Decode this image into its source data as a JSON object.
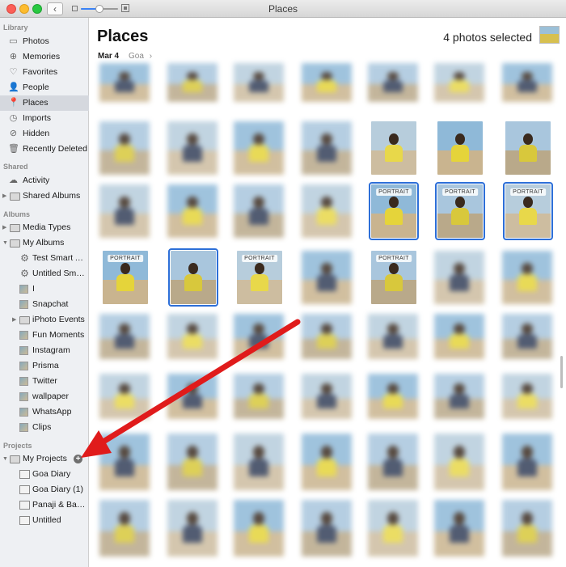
{
  "window": {
    "title": "Places"
  },
  "toolbar": {
    "back_glyph": "‹",
    "zoom_level": 0.5
  },
  "sidebar": {
    "sections": [
      {
        "key": "library",
        "label": "Library"
      },
      {
        "key": "shared",
        "label": "Shared"
      },
      {
        "key": "albums",
        "label": "Albums"
      },
      {
        "key": "projects",
        "label": "Projects"
      }
    ],
    "items": [
      {
        "label": "Photos",
        "icon": "photos-icon",
        "glyph": "▭"
      },
      {
        "label": "Memories",
        "icon": "memories-icon",
        "glyph": "⊕"
      },
      {
        "label": "Favorites",
        "icon": "heart-icon",
        "glyph": "♡"
      },
      {
        "label": "People",
        "icon": "person-icon",
        "glyph": "👤"
      },
      {
        "label": "Places",
        "icon": "pin-icon",
        "glyph": "📍",
        "selected": true
      },
      {
        "label": "Imports",
        "icon": "clock-icon",
        "glyph": "◷"
      },
      {
        "label": "Hidden",
        "icon": "eye-slash-icon",
        "glyph": "⊘"
      },
      {
        "label": "Recently Deleted",
        "icon": "trash-icon",
        "glyph": "🗑"
      },
      {
        "label": "Activity",
        "icon": "cloud-icon",
        "glyph": "☁"
      },
      {
        "label": "Shared Albums",
        "icon": "folder-icon",
        "glyph": ""
      },
      {
        "label": "Media Types",
        "icon": "folder-icon",
        "glyph": ""
      },
      {
        "label": "My Albums",
        "icon": "folder-icon",
        "glyph": ""
      },
      {
        "label": "Test Smart Album",
        "icon": "gear-icon",
        "glyph": "⚙"
      },
      {
        "label": "Untitled Smart Album",
        "icon": "gear-icon",
        "glyph": "⚙"
      },
      {
        "label": "I",
        "icon": "album-thumb-icon",
        "glyph": ""
      },
      {
        "label": "Snapchat",
        "icon": "album-thumb-icon",
        "glyph": ""
      },
      {
        "label": "iPhoto Events",
        "icon": "folder-icon",
        "glyph": ""
      },
      {
        "label": "Fun Moments",
        "icon": "album-thumb-icon",
        "glyph": ""
      },
      {
        "label": "Instagram",
        "icon": "album-thumb-icon",
        "glyph": ""
      },
      {
        "label": "Prisma",
        "icon": "album-thumb-icon",
        "glyph": ""
      },
      {
        "label": "Twitter",
        "icon": "album-thumb-icon",
        "glyph": ""
      },
      {
        "label": "wallpaper",
        "icon": "album-thumb-icon",
        "glyph": ""
      },
      {
        "label": "WhatsApp",
        "icon": "album-thumb-icon",
        "glyph": ""
      },
      {
        "label": "Clips",
        "icon": "album-thumb-icon",
        "glyph": ""
      },
      {
        "label": "My Projects",
        "icon": "folder-icon",
        "glyph": ""
      },
      {
        "label": "Goa Diary",
        "icon": "project-icon",
        "glyph": ""
      },
      {
        "label": "Goa Diary (1)",
        "icon": "project-icon",
        "glyph": ""
      },
      {
        "label": "Panaji & Baroda",
        "icon": "project-icon",
        "glyph": ""
      },
      {
        "label": "Untitled",
        "icon": "project-icon",
        "glyph": ""
      }
    ],
    "add_glyph": "+"
  },
  "main": {
    "title": "Places",
    "selected_count": "4 photos selected",
    "breadcrumb_date": "Mar 4",
    "breadcrumb_place": "Goa",
    "breadcrumb_chevron": "›",
    "portrait_badge": "PORTRAIT"
  },
  "colors": {
    "selection": "#2d6fd8",
    "arrow": "#e01b1b",
    "sidebar_bg": "#eef0f3"
  }
}
